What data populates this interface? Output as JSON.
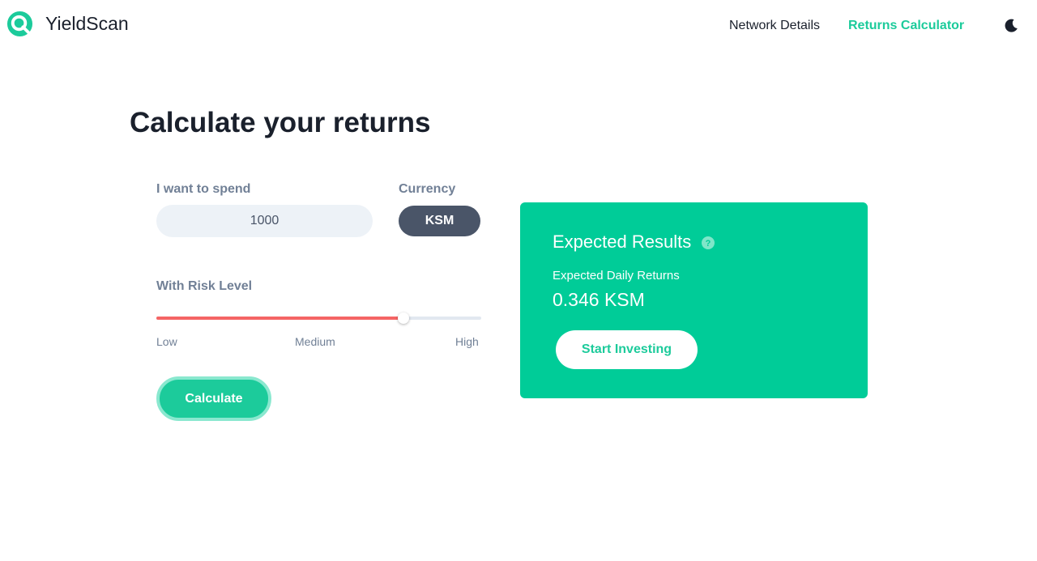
{
  "app": {
    "name": "YieldScan"
  },
  "nav": {
    "network_details": "Network Details",
    "returns_calculator": "Returns Calculator"
  },
  "page": {
    "title": "Calculate your returns"
  },
  "form": {
    "spend_label": "I want to spend",
    "spend_value": "1000",
    "currency_label": "Currency",
    "currency_value": "KSM",
    "risk_label": "With Risk Level",
    "risk_ticks": [
      "Low",
      "Medium",
      "High"
    ],
    "risk_level_fraction": 0.76,
    "calculate_label": "Calculate"
  },
  "results": {
    "title": "Expected Results",
    "daily_label": "Expected Daily Returns",
    "daily_value": "0.346 KSM",
    "start_label": "Start Investing"
  },
  "colors": {
    "accent": "#1ccb9b",
    "card": "#00cc98",
    "risk_fill": "#f56565",
    "pill": "#4a5568"
  }
}
